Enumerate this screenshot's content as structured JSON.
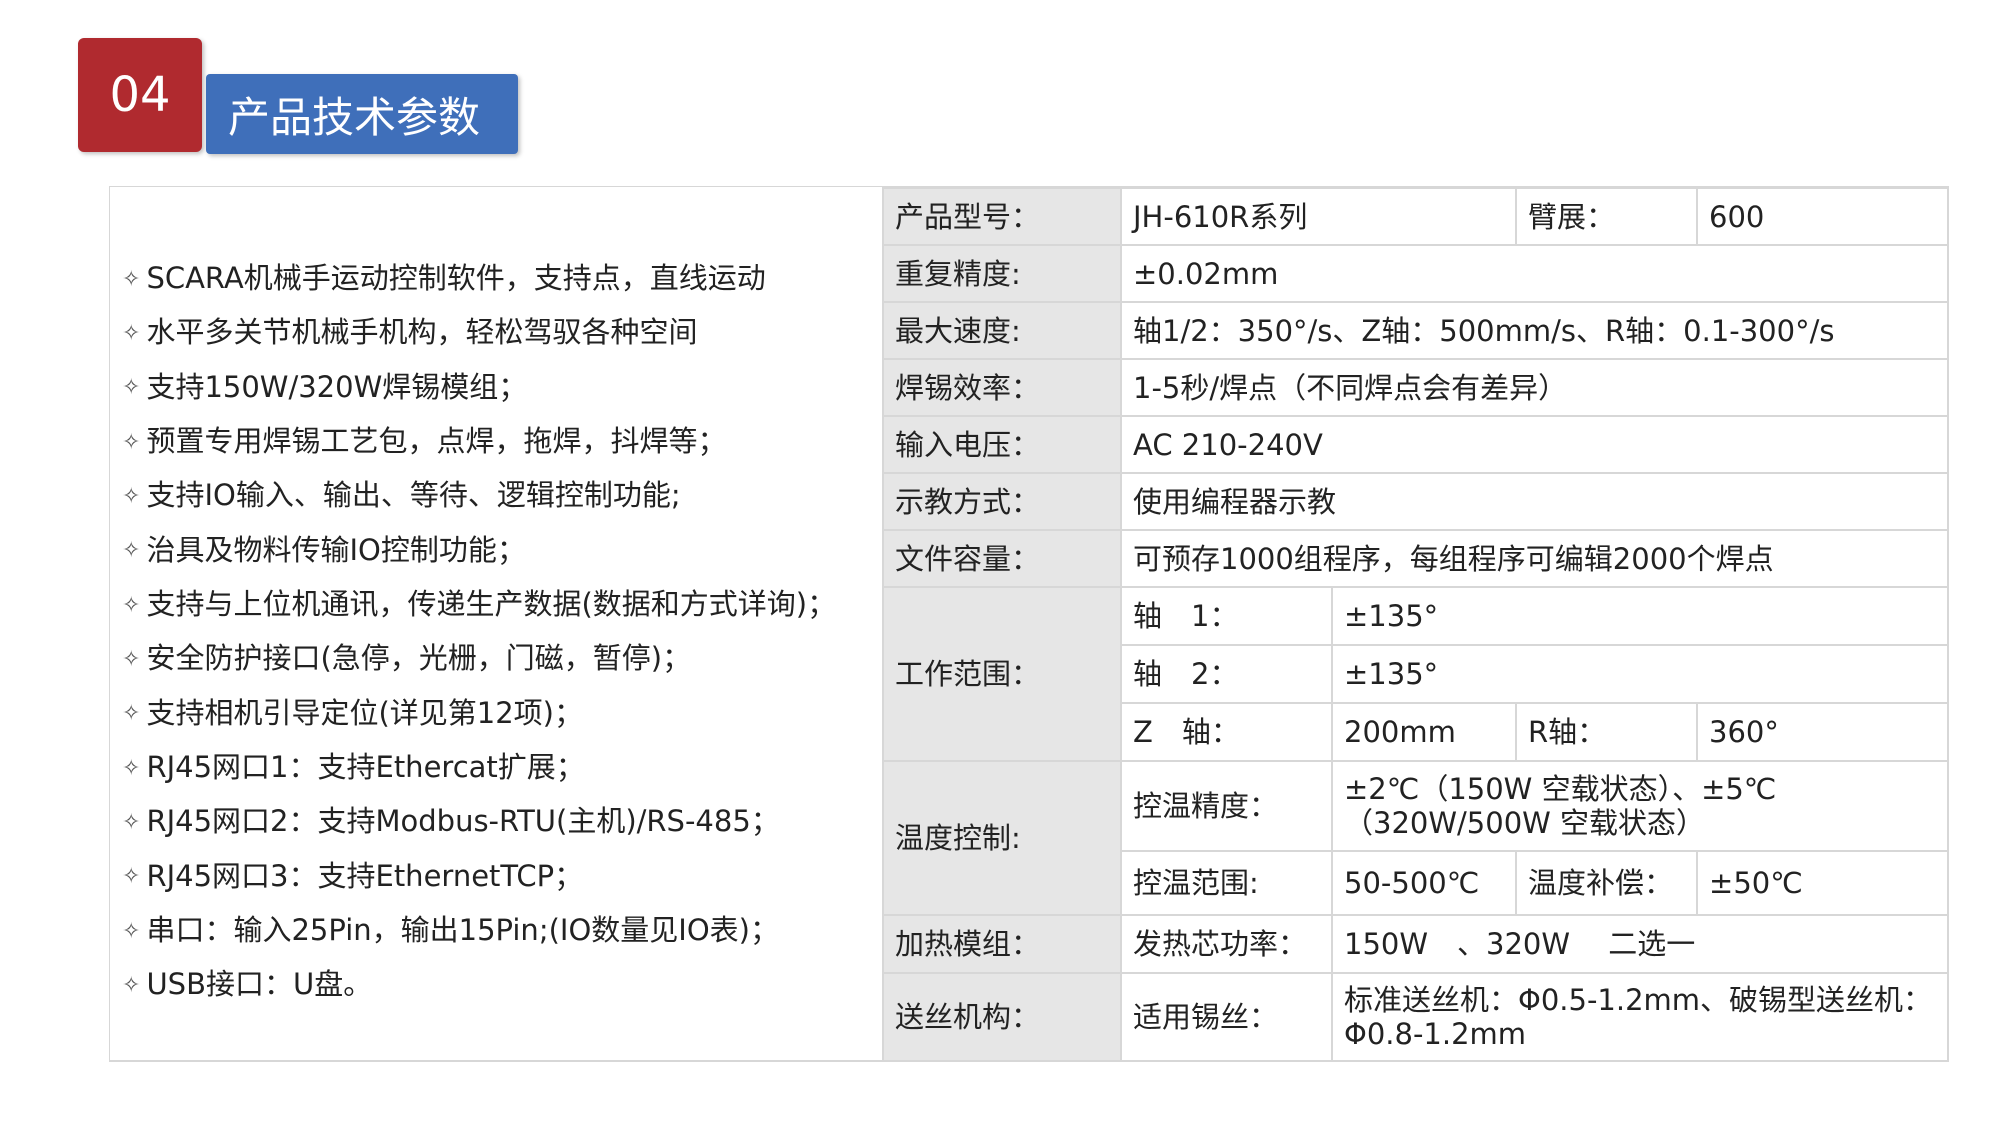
{
  "header": {
    "number": "04",
    "title": "产品技术参数"
  },
  "features": [
    "SCARA机械手运动控制软件，支持点，直线运动",
    "水平多关节机械手机构，轻松驾驭各种空间",
    "支持150W/320W焊锡模组；",
    "预置专用焊锡工艺包，点焊，拖焊，抖焊等；",
    "支持IO输入、输出、等待、逻辑控制功能;",
    "治具及物料传输IO控制功能；",
    "支持与上位机通讯，传递生产数据(数据和方式详询)；",
    "安全防护接口(急停，光栅，门磁，暂停)；",
    "支持相机引导定位(详见第12项)；",
    "RJ45网口1：支持Ethercat扩展；",
    "RJ45网口2：支持Modbus-RTU(主机)/RS-485；",
    "RJ45网口3：支持EthernetTCP；",
    "串口：输入25Pin，输出15Pin;(IO数量见IO表)；",
    "USB接口：U盘。"
  ],
  "bullet_icon": "diamond-star-icon",
  "spec": {
    "model_label": "产品型号：",
    "model_value": "JH-610R系列",
    "arm_label": "臂展：",
    "arm_value": "600",
    "repeat_label": "重复精度:",
    "repeat_value": "±0.02mm",
    "speed_label": "最大速度:",
    "speed_value": "轴1/2：350°/s、Z轴：500mm/s、R轴：0.1-300°/s",
    "eff_label": "焊锡效率：",
    "eff_value": "1-5秒/焊点（不同焊点会有差异）",
    "voltage_label": "输入电压：",
    "voltage_value": "AC 210-240V",
    "teach_label": "示教方式：",
    "teach_value": "使用编程器示教",
    "file_label": "文件容量：",
    "file_value": "可预存1000组程序，每组程序可编辑2000个焊点",
    "range_label": "工作范围：",
    "axis1_label": "轴　1：",
    "axis1_value": "±135°",
    "axis2_label": "轴　2：",
    "axis2_value": "±135°",
    "zaxis_label": "Z　轴：",
    "zaxis_value": "200mm",
    "raxis_label": "R轴：",
    "raxis_value": "360°",
    "temp_label": "温度控制:",
    "temp_prec_label": "控温精度：",
    "temp_prec_value_1": "±2℃（150W 空载状态）、±5℃",
    "temp_prec_value_2": "（320W/500W 空载状态）",
    "temp_range_label": "控温范围:",
    "temp_range_value": "50-500℃",
    "temp_comp_label": "温度补偿：",
    "temp_comp_value": "±50℃",
    "heat_label": "加热模组：",
    "heat_sub_label": "发热芯功率：",
    "heat_value": "150W　、320W　 二选一",
    "wire_label": "送丝机构：",
    "wire_sub_label": "适用锡丝：",
    "wire_value_1": "标准送丝机：Φ0.5-1.2mm、破锡型送丝机：",
    "wire_value_2": "Φ0.8-1.2mm"
  },
  "colors": {
    "number_badge": "#b02a2f",
    "title_bar": "#3f6fba",
    "label_cell": "#e6e6e6",
    "border": "#d7d7d7"
  }
}
